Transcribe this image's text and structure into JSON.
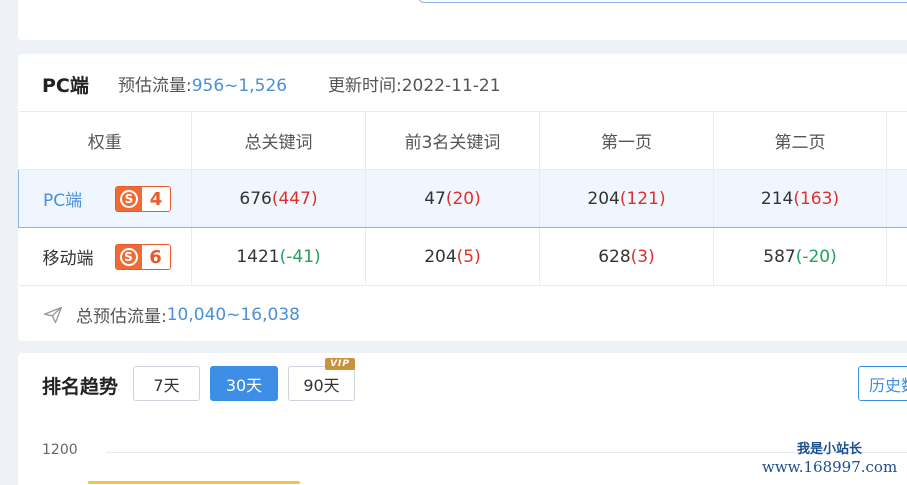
{
  "summary": {
    "title": "PC端",
    "traffic_label": "预估流量:",
    "traffic_value": "956~1,526",
    "update_label": "更新时间:",
    "update_value": "2022-11-21"
  },
  "table": {
    "headers": [
      "权重",
      "总关键词",
      "前3名关键词",
      "第一页",
      "第二页"
    ],
    "rows": [
      {
        "platform": "PC端",
        "weight": "4",
        "cells": [
          {
            "main": "676",
            "delta": "(447)",
            "dir": "up"
          },
          {
            "main": "47",
            "delta": "(20)",
            "dir": "up"
          },
          {
            "main": "204",
            "delta": "(121)",
            "dir": "up"
          },
          {
            "main": "214",
            "delta": "(163)",
            "dir": "up"
          }
        ]
      },
      {
        "platform": "移动端",
        "weight": "6",
        "cells": [
          {
            "main": "1421",
            "delta": "(-41)",
            "dir": "down"
          },
          {
            "main": "204",
            "delta": "(5)",
            "dir": "up"
          },
          {
            "main": "628",
            "delta": "(3)",
            "dir": "up"
          },
          {
            "main": "587",
            "delta": "(-20)",
            "dir": "down"
          }
        ]
      }
    ]
  },
  "total": {
    "label": "总预估流量:",
    "value": "10,040~16,038"
  },
  "trend": {
    "title": "排名趋势",
    "ranges": [
      "7天",
      "30天",
      "90天"
    ],
    "active_range": "30天",
    "vip_label": "VIP",
    "history_label": "历史数据",
    "y_tick": "1200"
  },
  "watermark": {
    "line1": "我是小站长",
    "line2": "www.168997.com"
  },
  "colors": {
    "accent": "#3d8ee6",
    "up": "#e0302e",
    "down": "#23a05a",
    "badge": "#f06a36"
  }
}
